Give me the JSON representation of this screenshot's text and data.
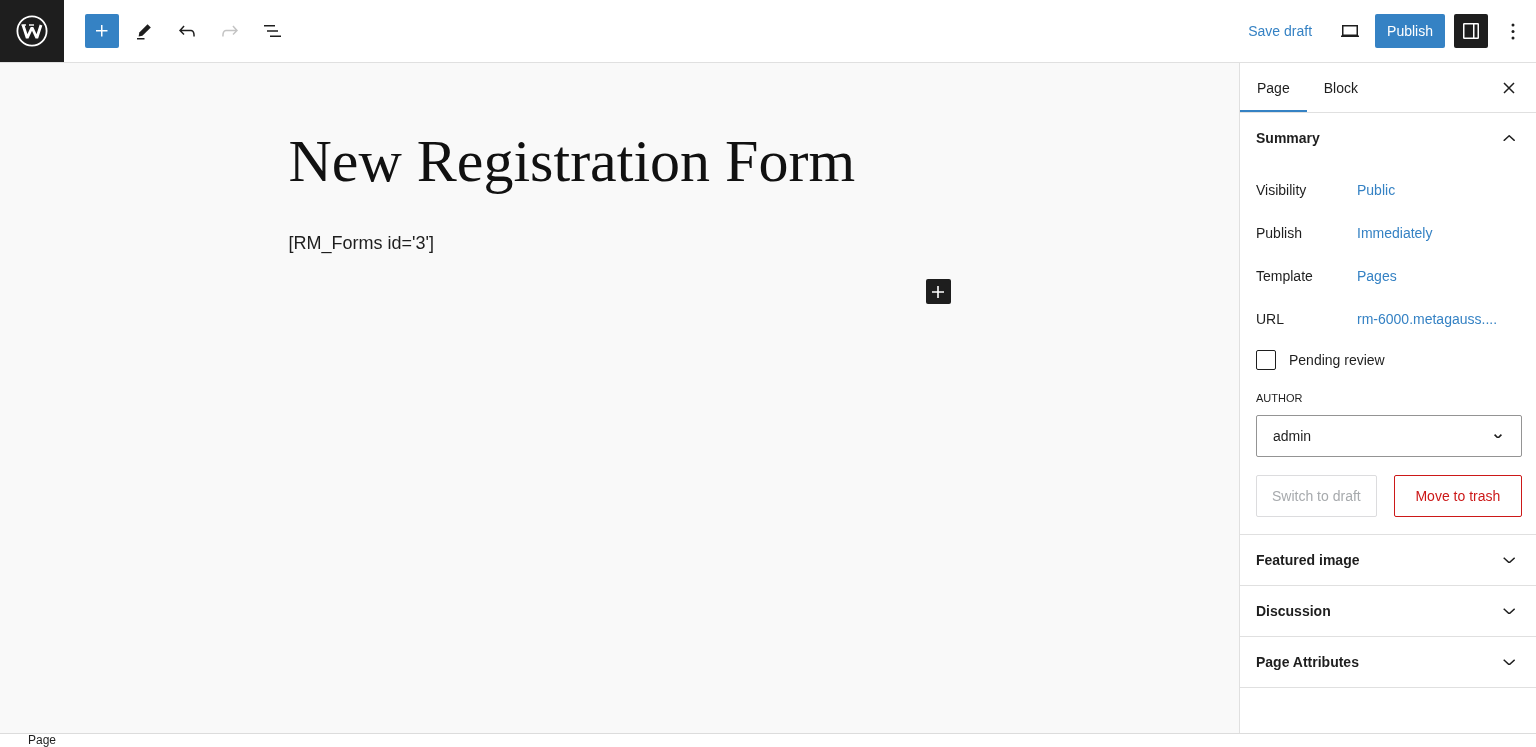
{
  "toolbar": {
    "tools": [
      {
        "kind": "inserter",
        "disabled": false
      },
      {
        "kind": "edit",
        "disabled": false
      },
      {
        "kind": "undo",
        "disabled": false
      },
      {
        "kind": "redo",
        "disabled": true
      },
      {
        "kind": "list-view",
        "disabled": false
      }
    ],
    "save_draft": "Save draft",
    "publish": "Publish",
    "settings_pressed": true
  },
  "editor": {
    "title": "New Registration Form",
    "paragraph": "[RM_Forms id='3']"
  },
  "sidebar": {
    "tabs": [
      {
        "label": "Page",
        "selected": true
      },
      {
        "label": "Block",
        "selected": false
      }
    ],
    "panels": [
      {
        "title": "Summary",
        "expanded": true,
        "rows": [
          {
            "label": "Visibility",
            "value": "Public"
          },
          {
            "label": "Publish",
            "value": "Immediately"
          },
          {
            "label": "Template",
            "value": "Pages"
          },
          {
            "label": "URL",
            "value": "rm-6000.metagauss...."
          }
        ],
        "pending_review": {
          "label": "Pending review",
          "checked": false
        },
        "author": {
          "label": "AUTHOR",
          "value": "admin"
        },
        "actions": [
          {
            "label": "Switch to draft",
            "kind": "secondary",
            "disabled": true
          },
          {
            "label": "Move to trash",
            "kind": "destructive",
            "disabled": false
          }
        ]
      },
      {
        "title": "Featured image",
        "expanded": false
      },
      {
        "title": "Discussion",
        "expanded": false
      },
      {
        "title": "Page Attributes",
        "expanded": false
      }
    ]
  },
  "footer": {
    "breadcrumb": "Page"
  }
}
